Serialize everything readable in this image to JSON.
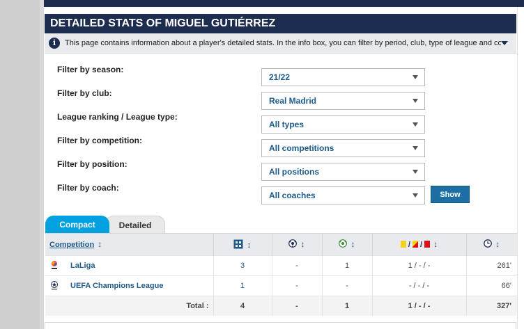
{
  "header": {
    "title": "DETAILED STATS OF MIGUEL GUTIÉRREZ"
  },
  "info": {
    "text": "This page contains information about a player's detailed stats. In the info box, you can filter by period, club, type of league and competition. Th..."
  },
  "filters": [
    {
      "label": "Filter by season:",
      "value": "21/22"
    },
    {
      "label": "Filter by club:",
      "value": "Real Madrid"
    },
    {
      "label": "League ranking / League type:",
      "value": "All types"
    },
    {
      "label": "Filter by competition:",
      "value": "All competitions"
    },
    {
      "label": "Filter by position:",
      "value": "All positions"
    },
    {
      "label": "Filter by coach:",
      "value": "All coaches"
    }
  ],
  "show_button": "Show",
  "tabs": {
    "compact": "Compact",
    "detailed": "Detailed"
  },
  "table": {
    "columns": {
      "competition": "Competition",
      "sort": "↕",
      "sep1": "/",
      "sep2": "/"
    },
    "rows": [
      {
        "competition": "LaLiga",
        "apps": "3",
        "goals": "-",
        "assists": "1",
        "cards": "1 / - / -",
        "minutes": "261'"
      },
      {
        "competition": "UEFA Champions League",
        "apps": "1",
        "goals": "-",
        "assists": "-",
        "cards": "- / - / -",
        "minutes": "66'"
      }
    ],
    "total": {
      "label": "Total :",
      "apps": "4",
      "goals": "-",
      "assists": "1",
      "cards": "1 / - / -",
      "minutes": "327'"
    }
  },
  "colors": {
    "navy": "#1d2d50",
    "accent": "#00a1de",
    "link": "#1d5a8a",
    "button": "#1d6fa3"
  },
  "icons": {
    "info": "info-circle-icon",
    "apps": "lineup-icon",
    "goals": "ball-icon",
    "assists": "assist-ball-icon",
    "cards": "cards-icon",
    "minutes": "clock-icon"
  }
}
